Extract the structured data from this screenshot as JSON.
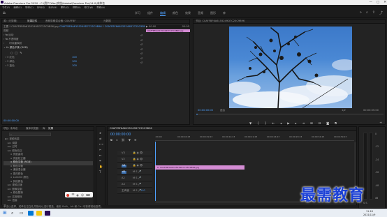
{
  "titlebar": {
    "title": "Adobe Premiere Pro 2020 - C:\\用户\\Ylbc\\文档\\Adobe\\Premiere Pro\\14.0\\未命名",
    "minimize": "—",
    "maximize": "□",
    "close": "✕"
  },
  "menu": [
    "文件(F)",
    "编辑(E)",
    "剪辑(C)",
    "序列(S)",
    "标记(M)",
    "图形(G)",
    "视图(V)",
    "窗口(W)",
    "帮助(H)"
  ],
  "workspaces": [
    "学习",
    "组件",
    "编辑",
    "颜色",
    "效果",
    "音频",
    "图形",
    "库"
  ],
  "effect_controls": {
    "tabs": [
      "源: (无剪辑)",
      "效果控件",
      "音频剪辑混合器: C0AFFBF",
      "元数据"
    ],
    "clip_path": "主要 * C0AFFBF6A6155249D7C25C9B96.jpg",
    "seq_path": "C0AFFBF6A6155249D7C25C9B96 * C0AFFBF6A6155249D7C25C9B96.jpg",
    "timecode_start": "▶ 00:00",
    "timecode_end": "00:05",
    "clip_label": "C0AFFBF6A6155249D7C25C9B96.jpg",
    "section_video": "视频",
    "fx_motion": "运动",
    "fx_opacity": "不透明度",
    "fx_time_remap": "时间重映射",
    "fx_color_balance": "颜色平衡 (RGB)",
    "prop_red": "红色",
    "prop_green": "绿色",
    "prop_blue": "蓝色",
    "value_red": "100",
    "value_green": "100",
    "value_blue": "100",
    "timecode_bottom": "00:00:00:00"
  },
  "program": {
    "title": "节目: C0AFFBF6A6155249D7C25C9B96",
    "timecode": "00:00:00:00",
    "fit": "适合",
    "ratio": "1/2",
    "duration": "00:00:05:00"
  },
  "project": {
    "tabs": [
      "项目: 未命名",
      "媒体浏览器",
      "库",
      "效果"
    ],
    "items": [
      "视频效果",
      "调整",
      "过时",
      "颜色校正",
      "亮度曲线",
      "亮度校正器",
      "颜色平衡 (RGB)",
      "颜色平衡",
      "通道混合器",
      "更改颜色",
      "Lumetri 颜色",
      "其他颜色",
      "视频过渡",
      "图像控制",
      "颜色替换",
      "实用程序",
      "扭曲"
    ],
    "selected_index": 6
  },
  "timeline": {
    "title": "C0AFFBF6A6155249D7C25C9B96",
    "timecode": "00:00:00:00",
    "ruler": [
      ":00:00",
      "00:00:04:23",
      "00:00:09:23",
      "00:00:14:23",
      "00:00:19:23",
      "00:00:24:23",
      "00:00:29:23",
      "00:00:34:23",
      "00:00:39:23"
    ],
    "tracks": [
      "V3",
      "V2",
      "V1",
      "A1",
      "A2",
      "A3",
      "主声道"
    ],
    "master_value": "0.0",
    "clip_label": "fx C0AFFBF6A6155249D7C25C9B96.jpg"
  },
  "meters": {
    "labels": [
      "0",
      "-12",
      "-24",
      "-36",
      "-48",
      "dB"
    ],
    "s_label": "S S"
  },
  "status": {
    "hint": "单击以选择，或单击空白处并拖动以进行框选。使用 Shift、Alt 和 Ctrl 可获得其他选项。"
  },
  "taskbar": {
    "time": "11:18",
    "date": "2021/11/9"
  },
  "watermark": "最需教育",
  "colors": {
    "accent": "#4ea1ff",
    "clip": "#d48cd4",
    "panel": "#232323"
  }
}
